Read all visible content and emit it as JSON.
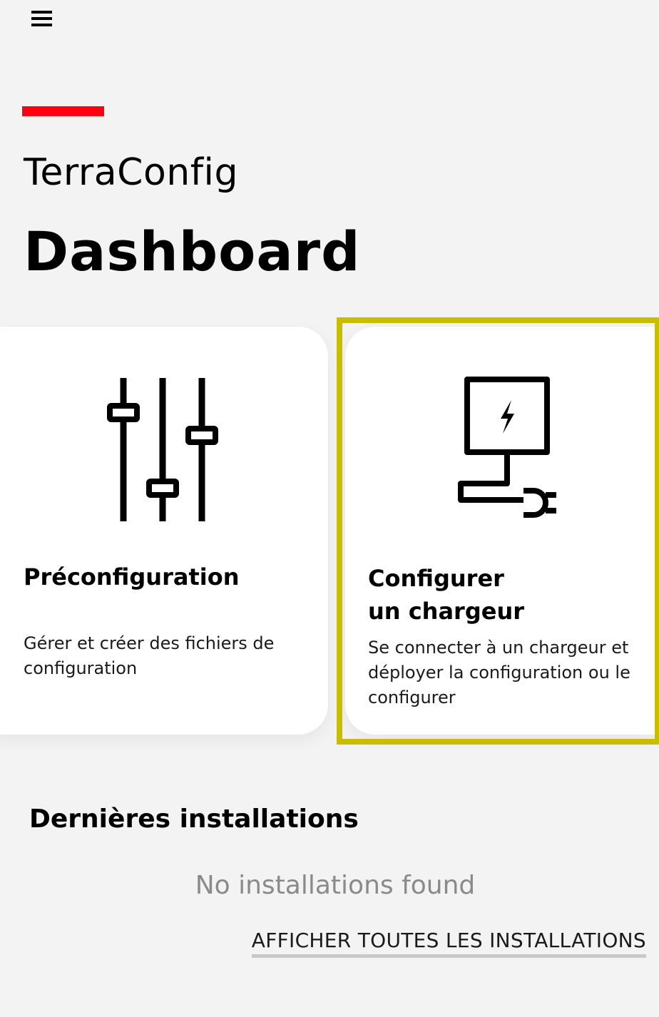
{
  "header": {
    "menu_icon": "hamburger-menu-icon",
    "accent_color": "#ff000f",
    "app_name": "TerraConfig",
    "title": "Dashboard"
  },
  "cards": [
    {
      "icon": "sliders-icon",
      "title": "Préconfiguration",
      "description": "Gérer et créer des fichiers de configuration"
    },
    {
      "icon": "charger-plug-icon",
      "title_line1": "Configurer",
      "title_line2": "un chargeur",
      "description": "Se connecter à un chargeur et déployer la configuration ou le configurer",
      "highlight_color": "#c9bd00"
    }
  ],
  "recent": {
    "title": "Dernières installations",
    "empty_message": "No installations found",
    "view_all_label": "AFFICHER TOUTES LES INSTALLATIONS"
  }
}
